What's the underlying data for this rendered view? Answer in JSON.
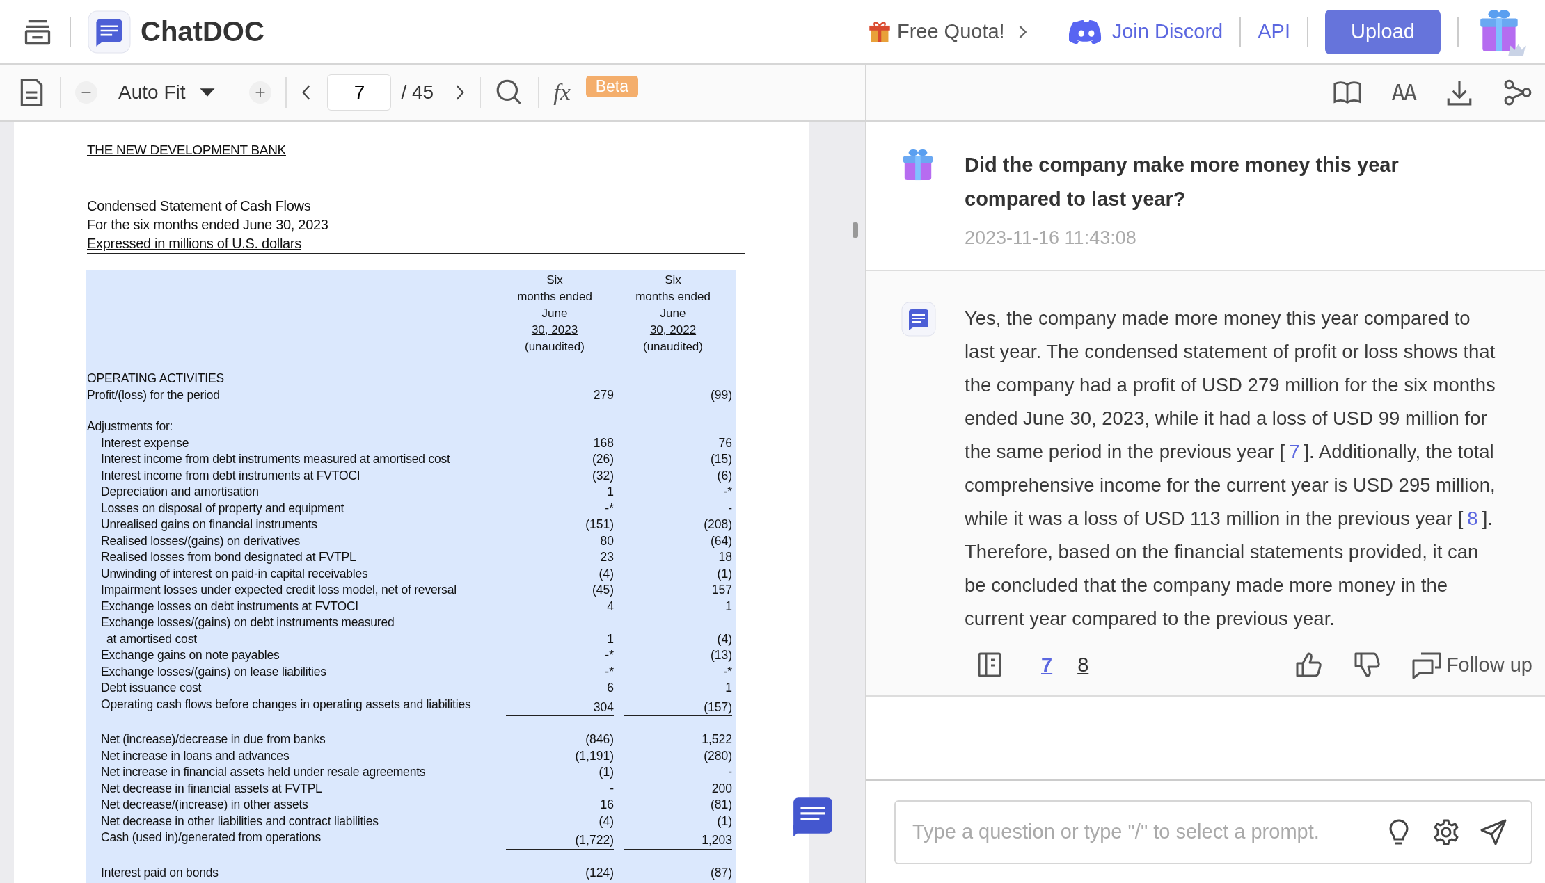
{
  "header": {
    "brand": "ChatDOC",
    "free_quota": "Free Quota!",
    "discord": "Join Discord",
    "api": "API",
    "upload": "Upload"
  },
  "toolbar": {
    "zoom_mode": "Auto Fit",
    "page": "7",
    "total": "/ 45",
    "formula": "fx",
    "beta": "Beta",
    "font_button": "AA"
  },
  "document": {
    "title": "THE NEW DEVELOPMENT BANK",
    "subtitle": [
      {
        "text": "Condensed Statement of Cash Flows",
        "underlined": false
      },
      {
        "text": "For the six months ended June 30, 2023",
        "underlined": false
      },
      {
        "text": "Expressed in millions of U.S. dollars",
        "underlined": true
      }
    ],
    "columns": [
      {
        "lines": [
          "Six",
          "months ended",
          "June"
        ],
        "date": "30, 2023",
        "note": "(unaudited)"
      },
      {
        "lines": [
          "Six",
          "months ended",
          "June"
        ],
        "date": "30, 2022",
        "note": "(unaudited)"
      }
    ],
    "blocks": [
      [
        {
          "kind": "heading",
          "label": "OPERATING ACTIVITIES"
        },
        {
          "kind": "line",
          "label": "Profit/(loss) for the period",
          "values": [
            "279",
            "(99)"
          ]
        }
      ],
      [
        {
          "kind": "heading",
          "label": "Adjustments for:"
        },
        {
          "kind": "item",
          "label": "Interest expense",
          "values": [
            "168",
            "76"
          ]
        },
        {
          "kind": "item",
          "label": "Interest income from debt instruments measured at amortised cost",
          "values": [
            "(26)",
            "(15)"
          ]
        },
        {
          "kind": "item",
          "label": "Interest income from debt instruments at FVTOCI",
          "values": [
            "(32)",
            "(6)"
          ]
        },
        {
          "kind": "item",
          "label": "Depreciation and amortisation",
          "values": [
            "1",
            "-*"
          ]
        },
        {
          "kind": "item",
          "label": "Losses on disposal of property and equipment",
          "values": [
            "-*",
            "-"
          ]
        },
        {
          "kind": "item",
          "label": "Unrealised gains on financial instruments",
          "values": [
            "(151)",
            "(208)"
          ]
        },
        {
          "kind": "item",
          "label": "Realised losses/(gains) on derivatives",
          "values": [
            "80",
            "(64)"
          ]
        },
        {
          "kind": "item",
          "label": "Realised losses from bond designated at FVTPL",
          "values": [
            "23",
            "18"
          ]
        },
        {
          "kind": "item",
          "label": "Unwinding of interest on paid-in capital receivables",
          "values": [
            "(4)",
            "(1)"
          ]
        },
        {
          "kind": "item",
          "label": "Impairment losses under expected credit loss model, net of reversal",
          "values": [
            "(45)",
            "157"
          ]
        },
        {
          "kind": "item",
          "label": "Exchange losses on debt instruments at FVTOCI",
          "values": [
            "4",
            "1"
          ]
        },
        {
          "kind": "item",
          "label": "Exchange losses/(gains) on debt instruments measured"
        },
        {
          "kind": "continuation",
          "label": "at amortised cost",
          "values": [
            "1",
            "(4)"
          ]
        },
        {
          "kind": "item",
          "label": "Exchange gains on note payables",
          "values": [
            "-*",
            "(13)"
          ]
        },
        {
          "kind": "item",
          "label": "Exchange losses/(gains) on lease liabilities",
          "values": [
            "-*",
            "-*"
          ]
        },
        {
          "kind": "item",
          "label": "Debt issuance cost",
          "values": [
            "6",
            "1"
          ]
        },
        {
          "kind": "subtotal",
          "label": "Operating cash flows before changes in operating assets and liabilities",
          "values": [
            "304",
            "(157)"
          ]
        }
      ],
      [
        {
          "kind": "item",
          "label": "Net (increase)/decrease in due from banks",
          "values": [
            "(846)",
            "1,522"
          ]
        },
        {
          "kind": "item",
          "label": "Net increase in loans and advances",
          "values": [
            "(1,191)",
            "(280)"
          ]
        },
        {
          "kind": "item",
          "label": "Net increase in financial assets held under resale agreements",
          "values": [
            "(1)",
            "-"
          ]
        },
        {
          "kind": "item",
          "label": "Net decrease in financial assets at FVTPL",
          "values": [
            "-",
            "200"
          ]
        },
        {
          "kind": "item",
          "label": "Net decrease/(increase) in other assets",
          "values": [
            "16",
            "(81)"
          ]
        },
        {
          "kind": "item",
          "label": "Net decrease in other liabilities and contract liabilities",
          "values": [
            "(4)",
            "(1)"
          ]
        },
        {
          "kind": "subtotal",
          "label": "Cash (used in)/generated from operations",
          "values": [
            "(1,722)",
            "1,203"
          ]
        }
      ],
      [
        {
          "kind": "item",
          "label": "Interest paid on bonds",
          "values": [
            "(124)",
            "(87)"
          ]
        }
      ]
    ]
  },
  "question": {
    "text": "Did the company make more money this year compared to last year?",
    "time": "2023-11-16 11:43:08"
  },
  "answer": {
    "parts": [
      {
        "text": "Yes, the company made more money this year compared to last year. The condensed statement of profit or loss shows that the company had a profit of USD 279 million for the six months ended June 30, 2023, while it had a loss of USD 99 million for the same period in the previous year ["
      },
      {
        "ref": "7"
      },
      {
        "text": "]. Additionally, the total comprehensive income for the current year is USD 295 million, while it was a loss of USD 113 million in the previous year ["
      },
      {
        "ref": "8"
      },
      {
        "text": "]. Therefore, based on the financial statements provided, it can be concluded that the company made more money in the current year compared to the previous year."
      }
    ],
    "sources": [
      {
        "label": "7",
        "selected": true
      },
      {
        "label": "8",
        "selected": false
      }
    ],
    "follow_up": "Follow up"
  },
  "input": {
    "placeholder": "Type a question or type \"/\" to select a prompt."
  }
}
